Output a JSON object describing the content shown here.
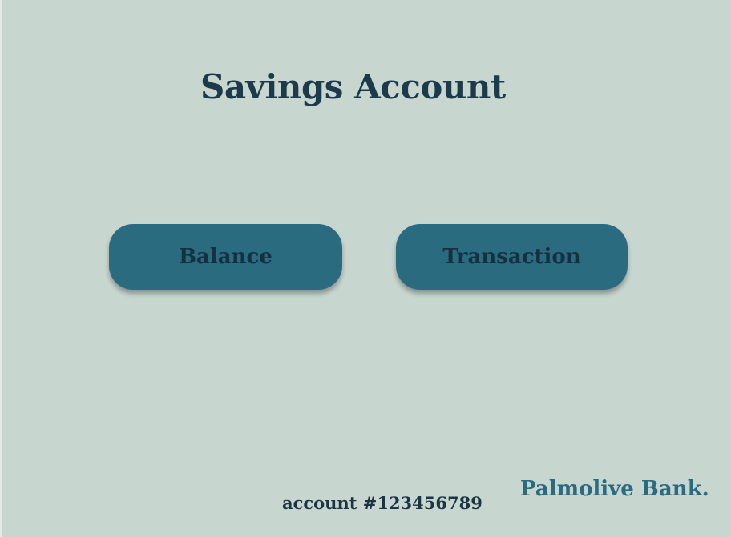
{
  "page": {
    "title": "Savings Account"
  },
  "buttons": {
    "balance": "Balance",
    "transaction": "Transaction"
  },
  "footer": {
    "account": "account #123456789",
    "brand": "Palmolive Bank."
  },
  "colors": {
    "background": "#c8d6d0",
    "button": "#2a6b80",
    "text": "#1d3a4a",
    "brand": "#2a6b80"
  }
}
